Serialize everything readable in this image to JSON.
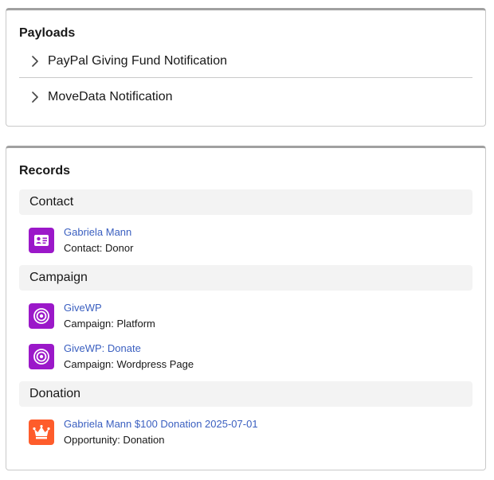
{
  "payloads": {
    "title": "Payloads",
    "items": [
      {
        "label": "PayPal Giving Fund Notification",
        "icon": "chevron-right-icon"
      },
      {
        "label": "MoveData Notification",
        "icon": "chevron-right-icon"
      }
    ]
  },
  "records": {
    "title": "Records",
    "sections": [
      {
        "header": "Contact",
        "items": [
          {
            "link": "Gabriela Mann",
            "sub": "Contact: Donor",
            "icon": "contact-card-icon",
            "icon_color": "#9b18c9"
          }
        ]
      },
      {
        "header": "Campaign",
        "items": [
          {
            "link": "GiveWP",
            "sub": "Campaign: Platform",
            "icon": "campaign-target-icon",
            "icon_color": "#9b18c9"
          },
          {
            "link": "GiveWP: Donate",
            "sub": "Campaign: Wordpress Page",
            "icon": "campaign-target-icon",
            "icon_color": "#9b18c9"
          }
        ]
      },
      {
        "header": "Donation",
        "items": [
          {
            "link": "Gabriela Mann $100 Donation 2025-07-01",
            "sub": "Opportunity: Donation",
            "icon": "opportunity-crown-icon",
            "icon_color": "#fe5c2b"
          }
        ]
      }
    ]
  },
  "colors": {
    "link": "#3a5fc0",
    "section_bg": "#f3f3f3",
    "border": "#c9c9c9"
  }
}
